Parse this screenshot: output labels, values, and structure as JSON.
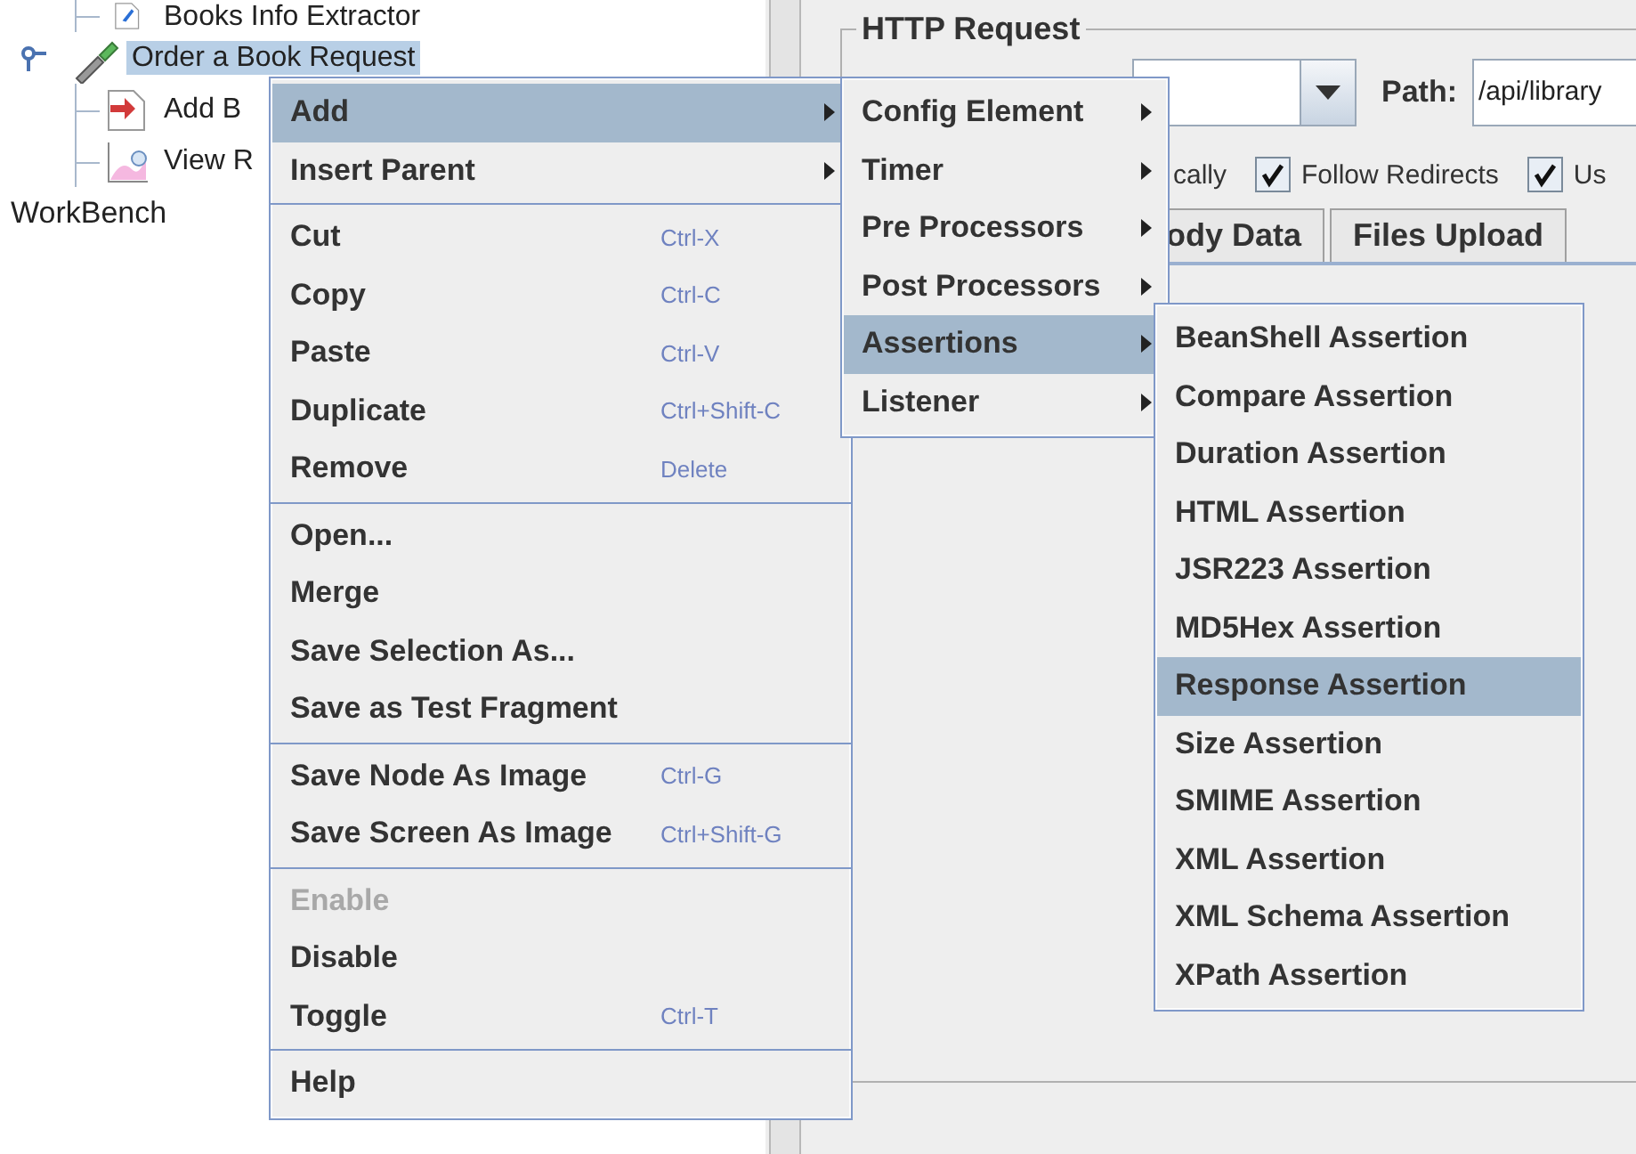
{
  "tree": {
    "continued_children": [
      {
        "kind": "extractor",
        "label": "Books Info Extractor",
        "selected": false
      }
    ],
    "items": [
      {
        "kind": "sampler",
        "label": "Order a Book Request",
        "selected": true,
        "expanded": true,
        "children": [
          {
            "kind": "preprocessor",
            "label": "Add B",
            "selected": false
          },
          {
            "kind": "listener",
            "label": "View R",
            "selected": false
          }
        ]
      }
    ],
    "workbench": {
      "label": "WorkBench"
    }
  },
  "http_request": {
    "title": "HTTP Request",
    "path_label": "Path:",
    "path_value": "/api/library",
    "cut_option_label": "cally",
    "options": [
      {
        "label": "Follow Redirects",
        "checked": true
      },
      {
        "label": "Us",
        "checked": true
      }
    ],
    "tabs": [
      {
        "label": "ody Data",
        "selected": false
      },
      {
        "label": "Files Upload",
        "selected": false
      }
    ]
  },
  "context_menu": {
    "groups": [
      [
        {
          "label": "Add",
          "has_submenu": true,
          "selected": true,
          "disabled": false
        },
        {
          "label": "Insert Parent",
          "has_submenu": true,
          "selected": false,
          "disabled": false
        }
      ],
      [
        {
          "label": "Cut",
          "shortcut": "Ctrl-X",
          "has_submenu": false,
          "selected": false,
          "disabled": false
        },
        {
          "label": "Copy",
          "shortcut": "Ctrl-C",
          "has_submenu": false,
          "selected": false,
          "disabled": false
        },
        {
          "label": "Paste",
          "shortcut": "Ctrl-V",
          "has_submenu": false,
          "selected": false,
          "disabled": false
        },
        {
          "label": "Duplicate",
          "shortcut": "Ctrl+Shift-C",
          "has_submenu": false,
          "selected": false,
          "disabled": false
        },
        {
          "label": "Remove",
          "shortcut": "Delete",
          "has_submenu": false,
          "selected": false,
          "disabled": false
        }
      ],
      [
        {
          "label": "Open...",
          "has_submenu": false,
          "selected": false,
          "disabled": false
        },
        {
          "label": "Merge",
          "has_submenu": false,
          "selected": false,
          "disabled": false
        },
        {
          "label": "Save Selection As...",
          "has_submenu": false,
          "selected": false,
          "disabled": false
        },
        {
          "label": "Save as Test Fragment",
          "has_submenu": false,
          "selected": false,
          "disabled": false
        }
      ],
      [
        {
          "label": "Save Node As Image",
          "shortcut": "Ctrl-G",
          "has_submenu": false,
          "selected": false,
          "disabled": false
        },
        {
          "label": "Save Screen As Image",
          "shortcut": "Ctrl+Shift-G",
          "has_submenu": false,
          "selected": false,
          "disabled": false
        }
      ],
      [
        {
          "label": "Enable",
          "has_submenu": false,
          "selected": false,
          "disabled": true
        },
        {
          "label": "Disable",
          "has_submenu": false,
          "selected": false,
          "disabled": false
        },
        {
          "label": "Toggle",
          "shortcut": "Ctrl-T",
          "has_submenu": false,
          "selected": false,
          "disabled": false
        }
      ],
      [
        {
          "label": "Help",
          "has_submenu": false,
          "selected": false,
          "disabled": false
        }
      ]
    ]
  },
  "add_submenu": {
    "items": [
      {
        "label": "Config Element",
        "has_submenu": true,
        "selected": false
      },
      {
        "label": "Timer",
        "has_submenu": true,
        "selected": false
      },
      {
        "label": "Pre Processors",
        "has_submenu": true,
        "selected": false
      },
      {
        "label": "Post Processors",
        "has_submenu": true,
        "selected": false
      },
      {
        "label": "Assertions",
        "has_submenu": true,
        "selected": true
      },
      {
        "label": "Listener",
        "has_submenu": true,
        "selected": false
      }
    ]
  },
  "assertions_submenu": {
    "items": [
      {
        "label": "BeanShell Assertion",
        "selected": false
      },
      {
        "label": "Compare Assertion",
        "selected": false
      },
      {
        "label": "Duration Assertion",
        "selected": false
      },
      {
        "label": "HTML Assertion",
        "selected": false
      },
      {
        "label": "JSR223 Assertion",
        "selected": false
      },
      {
        "label": "MD5Hex Assertion",
        "selected": false
      },
      {
        "label": "Response Assertion",
        "selected": true
      },
      {
        "label": "Size Assertion",
        "selected": false
      },
      {
        "label": "SMIME Assertion",
        "selected": false
      },
      {
        "label": "XML Assertion",
        "selected": false
      },
      {
        "label": "XML Schema Assertion",
        "selected": false
      },
      {
        "label": "XPath Assertion",
        "selected": false
      }
    ]
  }
}
